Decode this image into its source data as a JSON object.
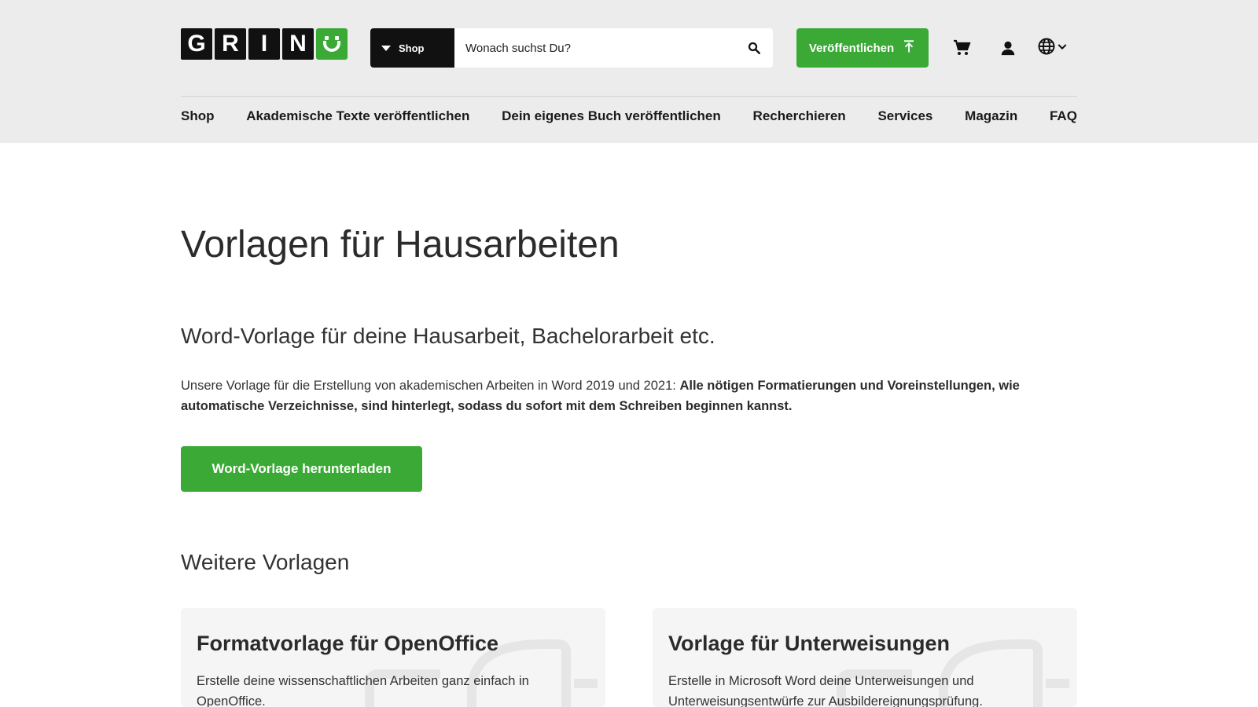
{
  "header": {
    "logo_letters": [
      "G",
      "R",
      "I",
      "N"
    ],
    "search": {
      "scope_label": "Shop",
      "placeholder": "Wonach suchst Du?"
    },
    "publish_label": "Veröffentlichen",
    "icons": [
      "search-icon",
      "upload-icon",
      "cart-icon",
      "user-icon",
      "globe-icon",
      "chevron-down-icon"
    ]
  },
  "nav": {
    "items": [
      {
        "label": "Shop"
      },
      {
        "label": "Akademische Texte veröffentlichen"
      },
      {
        "label": "Dein eigenes Buch veröffentlichen"
      },
      {
        "label": "Recherchieren"
      },
      {
        "label": "Services"
      },
      {
        "label": "Magazin"
      },
      {
        "label": "FAQ"
      }
    ]
  },
  "main": {
    "title": "Vorlagen für Hausarbeiten",
    "subtitle": "Word-Vorlage für deine Hausarbeit, Bachelorarbeit etc.",
    "intro_plain": "Unsere Vorlage für die Erstellung von akademischen Arbeiten in Word 2019 und 2021: ",
    "intro_bold": "Alle nötigen Formatierungen und Voreinstellungen, wie automatische Verzeichnisse, sind hinterlegt, sodass du sofort mit dem Schreiben beginnen kannst.",
    "download_label": "Word-Vorlage herunterladen",
    "more_heading": "Weitere Vorlagen",
    "cards": [
      {
        "title": "Formatvorlage für OpenOffice",
        "text": "Erstelle deine wissenschaftlichen Arbeiten ganz einfach in OpenOffice."
      },
      {
        "title": "Vorlage für Unterweisungen",
        "text": "Erstelle in Microsoft Word deine Unterweisungen und Unterweisungsentwürfe zur Ausbildereignungsprüfung."
      }
    ]
  },
  "colors": {
    "accent": "#3aa935",
    "header_bg": "#ececec",
    "dark": "#111111"
  }
}
